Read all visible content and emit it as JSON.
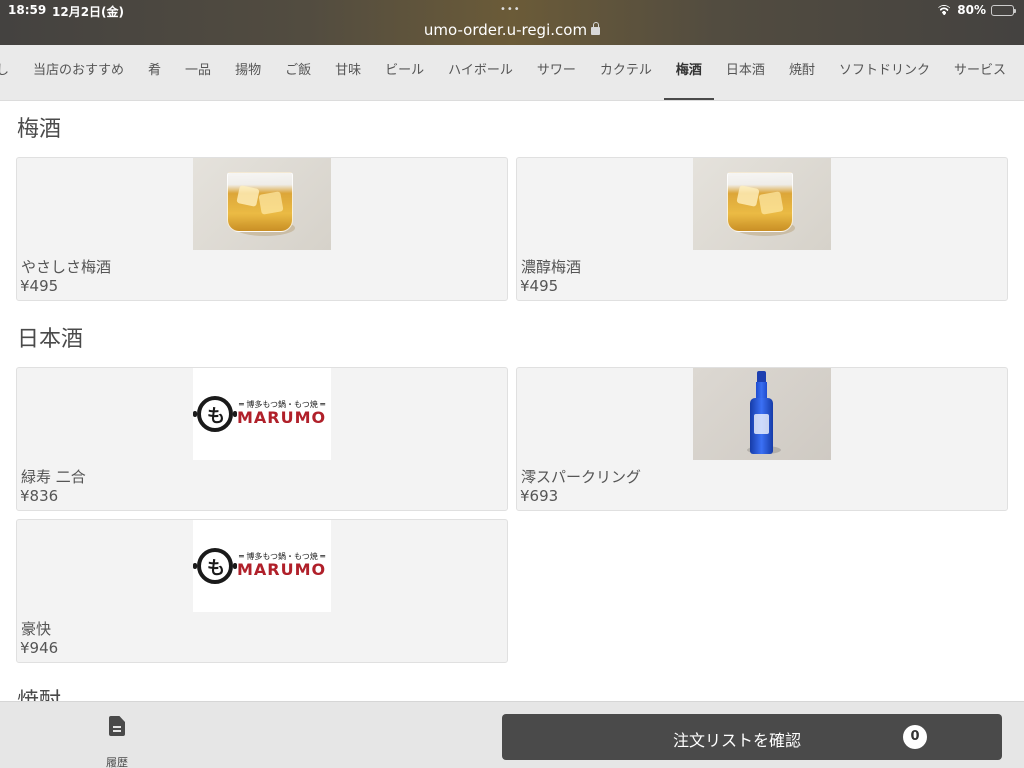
{
  "status_bar": {
    "time": "18:59",
    "date": "12月2日(金)",
    "dots": "•••",
    "url": "umo-order.u-regi.com",
    "battery": "80%",
    "battery_level": 0.8
  },
  "tabs": [
    {
      "label": "し",
      "active": false
    },
    {
      "label": "当店のおすすめ",
      "active": false
    },
    {
      "label": "肴",
      "active": false
    },
    {
      "label": "一品",
      "active": false
    },
    {
      "label": "揚物",
      "active": false
    },
    {
      "label": "ご飯",
      "active": false
    },
    {
      "label": "甘味",
      "active": false
    },
    {
      "label": "ビール",
      "active": false
    },
    {
      "label": "ハイボール",
      "active": false
    },
    {
      "label": "サワー",
      "active": false
    },
    {
      "label": "カクテル",
      "active": false
    },
    {
      "label": "梅酒",
      "active": true
    },
    {
      "label": "日本酒",
      "active": false
    },
    {
      "label": "焼酎",
      "active": false
    },
    {
      "label": "ソフトドリンク",
      "active": false
    },
    {
      "label": "サービス",
      "active": false
    }
  ],
  "sections": [
    {
      "title": "梅酒",
      "items": [
        {
          "name": "やさしさ梅酒",
          "price": "¥495",
          "image": "umeshu-glass-photo"
        },
        {
          "name": "濃醇梅酒",
          "price": "¥495",
          "image": "umeshu-glass-photo"
        }
      ]
    },
    {
      "title": "日本酒",
      "items": [
        {
          "name": "緑寿 二合",
          "price": "¥836",
          "image": "marumo-logo"
        },
        {
          "name": "澪スパークリング",
          "price": "¥693",
          "image": "blue-sake-bottle-photo"
        },
        {
          "name": "豪快",
          "price": "¥946",
          "image": "marumo-logo"
        }
      ]
    },
    {
      "title": "焼酎",
      "items": []
    }
  ],
  "logo": {
    "glyph": "も",
    "tagline": "═ 博多もつ鍋・もつ焼 ═",
    "text": "MARUMO"
  },
  "bottom_bar": {
    "history_label": "履歴",
    "history_icon": "document-icon",
    "order_button_label": "注文リストを確認",
    "order_count": "0"
  }
}
